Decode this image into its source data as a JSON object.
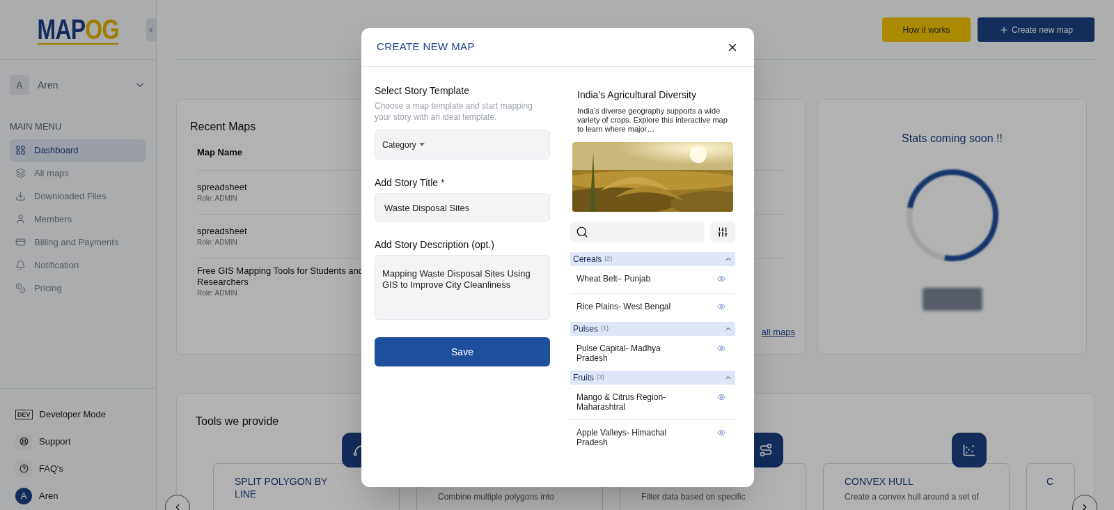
{
  "logo": {
    "text": "MAPOG"
  },
  "sidebar": {
    "user": {
      "initial": "A",
      "name": "Aren"
    },
    "section": "MAIN MENU",
    "items": [
      {
        "label": "Dashboard",
        "selected": true
      },
      {
        "label": "All maps",
        "selected": false
      },
      {
        "label": "Downloaded Files",
        "selected": false
      },
      {
        "label": "Members",
        "selected": false
      },
      {
        "label": "Billing and Payments",
        "selected": false
      },
      {
        "label": "Notification",
        "selected": false
      },
      {
        "label": "Pricing",
        "selected": false
      }
    ],
    "bottom": [
      {
        "kind": "dev",
        "badge": "DEV",
        "label": "Developer Mode"
      },
      {
        "kind": "support",
        "label": "Support"
      },
      {
        "kind": "faq",
        "label": "FAQ's"
      },
      {
        "kind": "avatar",
        "badge": "A",
        "label": "Aren"
      }
    ]
  },
  "header": {
    "buttons": [
      {
        "kind": "secondary",
        "label": "How it works"
      },
      {
        "kind": "primary",
        "label": "Create new map"
      }
    ]
  },
  "recent_maps": {
    "title": "Recent Maps",
    "column": "Map Name",
    "rows": [
      {
        "name": "spreadsheet",
        "role": "Role: ADMIN"
      },
      {
        "name": "spreadsheet",
        "role": "Role: ADMIN"
      },
      {
        "name": "Free GIS Mapping Tools for Students and Researchers",
        "role": "Role: ADMIN"
      }
    ],
    "link": "all maps"
  },
  "stats": {
    "title": "Stats coming soon !!"
  },
  "tools": {
    "title": "Tools we provide",
    "cards": [
      {
        "title": "SPLIT POLYGON BY LINE"
      },
      {
        "description": "Combine multiple polygons into"
      },
      {
        "description": "Filter data based on specific"
      },
      {
        "title": "CONVEX HULL",
        "description": "Create a convex hull around a set of"
      },
      {
        "title": "C"
      }
    ]
  },
  "modal": {
    "title": "CREATE NEW MAP",
    "section": "Select Story Template",
    "subtitle": "Choose a map template and start mapping your story with an ideal template.",
    "category": "Category",
    "title_label": "Add Story Title *",
    "title_value": "Waste Disposal Sites",
    "description_label": "Add Story Description (opt.)",
    "description_value": "Mapping Waste Disposal Sites Using GIS to Improve City Cleanliness",
    "save": "Save",
    "template": {
      "title": "India’s Agricultural Diversity",
      "description": "India’s diverse geography supports a wide variety of crops. Explore this interactive map to learn where major…"
    },
    "groups": [
      {
        "name": "Cereals",
        "count": "(2)",
        "expanded": true,
        "items": [
          "Wheat Belt– Punjab",
          "Rice Plains- West Bengal"
        ]
      },
      {
        "name": "Pulses",
        "count": "(1)",
        "expanded": true,
        "items": [
          "Pulse Capital- Madhya Pradesh"
        ]
      },
      {
        "name": "Fruits",
        "count": "(3)",
        "expanded": true,
        "items": [
          "Mango & Citrus Region- Maharashtral",
          "Apple Valleys- Himachal Pradesh"
        ]
      }
    ]
  }
}
